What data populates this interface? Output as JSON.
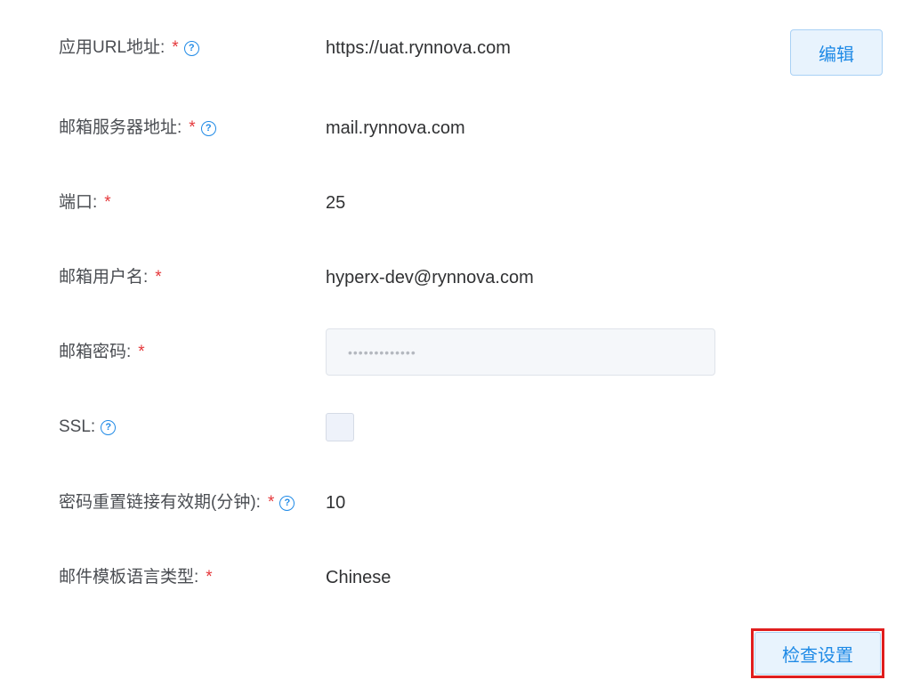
{
  "fields": {
    "app_url": {
      "label": "应用URL地址:",
      "required": "*",
      "help": "?",
      "value": "https://uat.rynnova.com"
    },
    "mail_server": {
      "label": "邮箱服务器地址:",
      "required": "*",
      "help": "?",
      "value": "mail.rynnova.com"
    },
    "port": {
      "label": "端口:",
      "required": "*",
      "value": "25"
    },
    "mail_user": {
      "label": "邮箱用户名:",
      "required": "*",
      "value": "hyperx-dev@rynnova.com"
    },
    "mail_password": {
      "label": "邮箱密码:",
      "required": "*",
      "value": "•••••••••••••"
    },
    "ssl": {
      "label": "SSL:",
      "help": "?",
      "checked": false
    },
    "reset_link_validity": {
      "label": "密码重置链接有效期(分钟):",
      "required": "*",
      "help": "?",
      "value": "10"
    },
    "template_language": {
      "label": "邮件模板语言类型:",
      "required": "*",
      "value": "Chinese"
    }
  },
  "actions": {
    "edit_label": "编辑",
    "check_settings_label": "检查设置"
  },
  "colors": {
    "accent": "#1f8ae6",
    "required": "#e5383b",
    "highlight": "#e01e1e"
  }
}
